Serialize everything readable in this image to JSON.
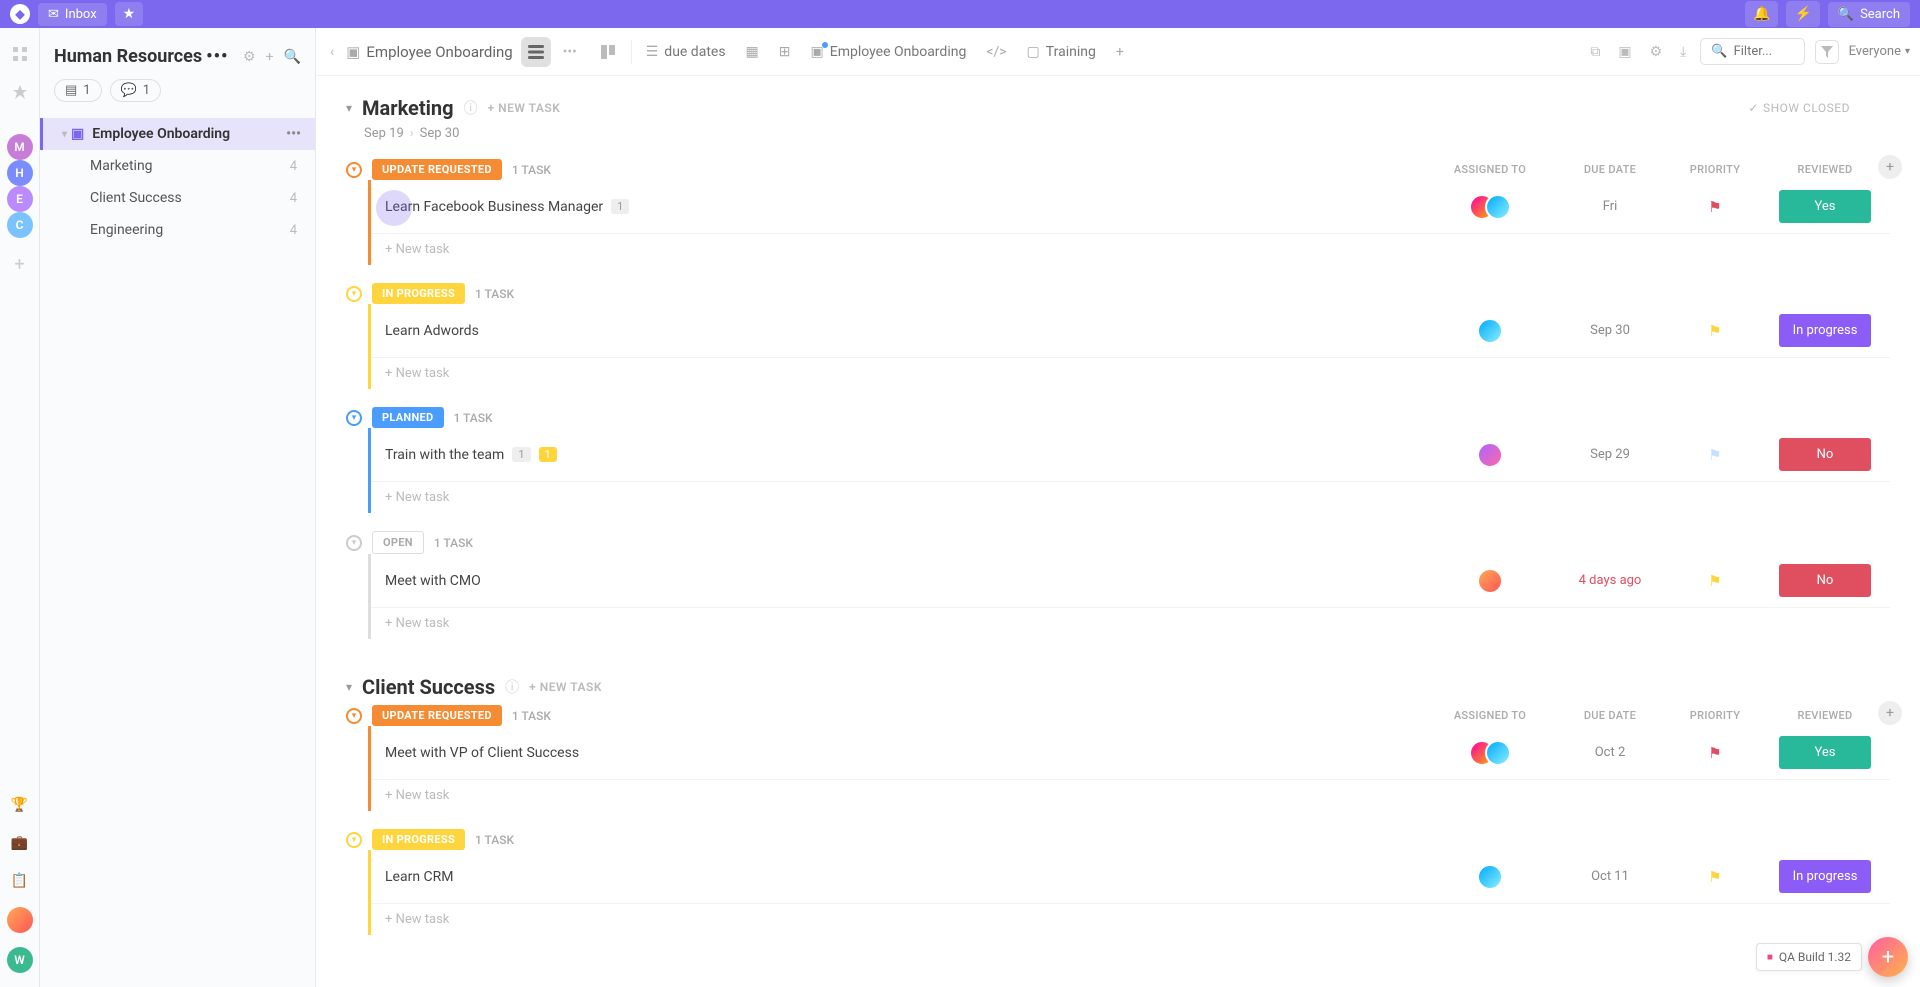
{
  "topbar": {
    "inbox_label": "Inbox",
    "search_label": "Search"
  },
  "sidebar": {
    "title": "Human Resources",
    "doc_count": "1",
    "comment_count": "1",
    "active_item": "Employee Onboarding",
    "subitems": [
      {
        "label": "Marketing",
        "count": "4"
      },
      {
        "label": "Client Success",
        "count": "4"
      },
      {
        "label": "Engineering",
        "count": "4"
      }
    ],
    "avatars": [
      {
        "letter": "M",
        "color": "#c77dd8"
      },
      {
        "letter": "H",
        "color": "#7b8cff"
      },
      {
        "letter": "E",
        "color": "#b98bff"
      },
      {
        "letter": "C",
        "color": "#7bc3ff"
      }
    ],
    "bottom_avatar": {
      "letter": "W",
      "color": "#3bb98f"
    }
  },
  "toolbar": {
    "breadcrumb": "Employee Onboarding",
    "tabs": {
      "due_dates": "due dates",
      "onboarding": "Employee Onboarding",
      "training": "Training"
    },
    "filter_placeholder": "Filter...",
    "everyone_label": "Everyone"
  },
  "columns": {
    "assigned": "ASSIGNED TO",
    "due": "DUE DATE",
    "priority": "PRIORITY",
    "reviewed": "REVIEWED"
  },
  "labels": {
    "new_task_upper": "+ NEW TASK",
    "new_task": "+ New task",
    "show_closed": "SHOW CLOSED",
    "task_single": "1 TASK"
  },
  "status_labels": {
    "update": "UPDATE REQUESTED",
    "progress": "IN PROGRESS",
    "planned": "PLANNED",
    "open": "OPEN"
  },
  "reviewed_chips": {
    "yes": "Yes",
    "no": "No",
    "in_progress": "In progress"
  },
  "groups": [
    {
      "name": "Marketing",
      "date_start": "Sep 19",
      "date_end": "Sep 30",
      "sections": [
        {
          "status": "update",
          "tasks": [
            {
              "name": "Learn Facebook Business Manager",
              "badges": [
                {
                  "text": "1",
                  "type": "grey"
                }
              ],
              "avatars": 2,
              "due": "Fri",
              "flag": "#e04f5f",
              "reviewed": "yes"
            }
          ]
        },
        {
          "status": "progress",
          "tasks": [
            {
              "name": "Learn Adwords",
              "badges": [],
              "avatars": 1,
              "due": "Sep 30",
              "flag": "#ffd53d",
              "reviewed": "in_progress"
            }
          ]
        },
        {
          "status": "planned",
          "tasks": [
            {
              "name": "Train with the team",
              "badges": [
                {
                  "text": "1",
                  "type": "grey"
                },
                {
                  "text": "1",
                  "type": "yellow"
                }
              ],
              "avatars": 1,
              "due": "Sep 29",
              "flag": "#c7e0ff",
              "reviewed": "no"
            }
          ]
        },
        {
          "status": "open",
          "tasks": [
            {
              "name": "Meet with CMO",
              "badges": [],
              "avatars": 1,
              "due": "4 days ago",
              "overdue": true,
              "flag": "#ffd53d",
              "reviewed": "no"
            }
          ]
        }
      ]
    },
    {
      "name": "Client Success",
      "sections": [
        {
          "status": "update",
          "tasks": [
            {
              "name": "Meet with VP of Client Success",
              "badges": [],
              "avatars": 2,
              "due": "Oct 2",
              "flag": "#e04f5f",
              "reviewed": "yes"
            }
          ]
        },
        {
          "status": "progress",
          "tasks": [
            {
              "name": "Learn CRM",
              "badges": [],
              "avatars": 1,
              "due": "Oct 11",
              "flag": "#ffd53d",
              "reviewed": "in_progress"
            }
          ]
        }
      ]
    }
  ],
  "qa_build": "QA Build 1.32"
}
